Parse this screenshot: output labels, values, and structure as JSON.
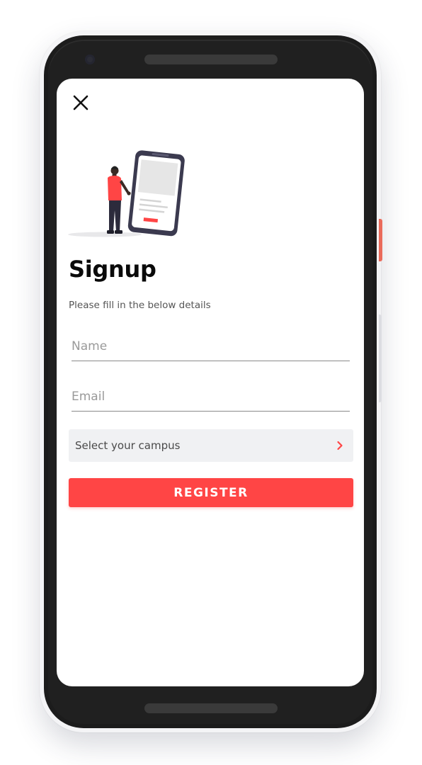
{
  "screen": {
    "close_icon": "close-icon",
    "title": "Signup",
    "subtitle": "Please fill in the below details"
  },
  "form": {
    "name": {
      "value": "",
      "placeholder": "Name"
    },
    "email": {
      "value": "",
      "placeholder": "Email"
    },
    "campus": {
      "label": "Select your campus",
      "icon": "chevron-right-icon"
    },
    "register_label": "REGISTER"
  },
  "colors": {
    "accent": "#ff4545",
    "select_bg": "#f0f1f3",
    "title": "#0a0a0a",
    "phone_frame": "#1c1c1c"
  }
}
